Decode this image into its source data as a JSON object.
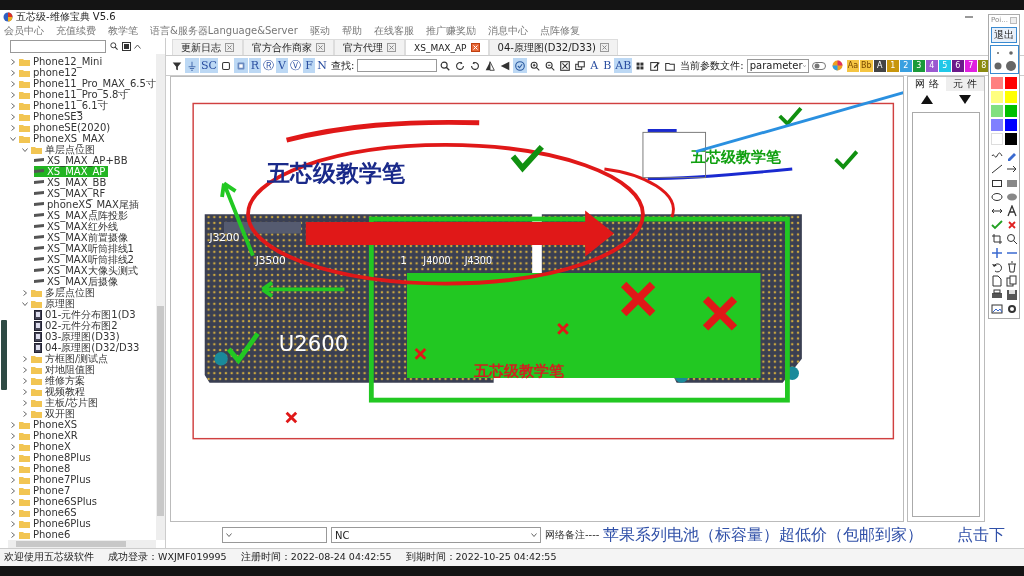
{
  "window": {
    "title": "五芯级-维修宝典 V5.6"
  },
  "menu": [
    "会员中心",
    "充值续费",
    "教学笔",
    "语言&服务器Language&Server",
    "驱动",
    "帮助",
    "在线客服",
    "推广赚奖励",
    "消息中心",
    "点阵修复"
  ],
  "sidebar": {
    "tree": [
      {
        "label": "Phone12_Mini",
        "kind": "folder",
        "expanded": false,
        "selected": false
      },
      {
        "label": "phone12",
        "kind": "folder",
        "expanded": false,
        "selected": false
      },
      {
        "label": "Phone11_Pro_MAX_6.5寸",
        "kind": "folder",
        "expanded": false,
        "selected": false
      },
      {
        "label": "Phone11_Pro_5.8寸",
        "kind": "folder",
        "expanded": false,
        "selected": false
      },
      {
        "label": "Phone11_6.1寸",
        "kind": "folder",
        "expanded": false,
        "selected": false
      },
      {
        "label": "PhoneSE3",
        "kind": "folder",
        "expanded": false,
        "selected": false
      },
      {
        "label": "phoneSE(2020)",
        "kind": "folder",
        "expanded": false,
        "selected": false
      },
      {
        "label": "PhoneXS_MAX",
        "kind": "folder",
        "expanded": true,
        "selected": false,
        "children": [
          {
            "label": "单层点位图",
            "kind": "folder",
            "expanded": true,
            "selected": false,
            "children": [
              {
                "label": "XS_MAX_AP+BB",
                "kind": "board",
                "selected": false
              },
              {
                "label": "XS_MAX_AP",
                "kind": "board",
                "selected": true
              },
              {
                "label": "XS_MAX_BB",
                "kind": "board",
                "selected": false
              },
              {
                "label": "XS_MAX_RF",
                "kind": "board",
                "selected": false
              },
              {
                "label": "phoneXS_MAX尾插",
                "kind": "board",
                "selected": false
              },
              {
                "label": "XS_MAX点阵投影",
                "kind": "board",
                "selected": false
              },
              {
                "label": "XS_MAX红外线",
                "kind": "board",
                "selected": false
              },
              {
                "label": "XS_MAX前置摄像",
                "kind": "board",
                "selected": false
              },
              {
                "label": "XS_MAX听筒排线1",
                "kind": "board",
                "selected": false
              },
              {
                "label": "XS_MAX听筒排线2",
                "kind": "board",
                "selected": false
              },
              {
                "label": "XS_MAX大像头测式",
                "kind": "board",
                "selected": false
              },
              {
                "label": "XS_MAX后摄像",
                "kind": "board",
                "selected": false
              }
            ]
          },
          {
            "label": "多层点位图",
            "kind": "folder",
            "expanded": false,
            "selected": false
          },
          {
            "label": "原理图",
            "kind": "folder",
            "expanded": true,
            "selected": false,
            "children": [
              {
                "label": "01-元件分布图1(D3",
                "kind": "schematic",
                "selected": false
              },
              {
                "label": "02-元件分布图2",
                "kind": "schematic",
                "selected": false
              },
              {
                "label": "03-原理图(D33)",
                "kind": "schematic",
                "selected": false
              },
              {
                "label": "04-原理图(D32/D33",
                "kind": "schematic",
                "selected": false
              }
            ]
          },
          {
            "label": "方框图/测试点",
            "kind": "folder",
            "expanded": false,
            "selected": false
          },
          {
            "label": "对地阻值图",
            "kind": "folder",
            "expanded": false,
            "selected": false
          },
          {
            "label": "维修方案",
            "kind": "folder",
            "expanded": false,
            "selected": false
          },
          {
            "label": "视频教程",
            "kind": "folder",
            "expanded": false,
            "selected": false
          },
          {
            "label": "主板/芯片图",
            "kind": "folder",
            "expanded": false,
            "selected": false
          },
          {
            "label": "双开图",
            "kind": "folder",
            "expanded": false,
            "selected": false
          }
        ]
      },
      {
        "label": "PhoneXS",
        "kind": "folder",
        "expanded": false,
        "selected": false
      },
      {
        "label": "PhoneXR",
        "kind": "folder",
        "expanded": false,
        "selected": false
      },
      {
        "label": "PhoneX",
        "kind": "folder",
        "expanded": false,
        "selected": false
      },
      {
        "label": "Phone8Plus",
        "kind": "folder",
        "expanded": false,
        "selected": false
      },
      {
        "label": "Phone8",
        "kind": "folder",
        "expanded": false,
        "selected": false
      },
      {
        "label": "Phone7Plus",
        "kind": "folder",
        "expanded": false,
        "selected": false
      },
      {
        "label": "Phone7",
        "kind": "folder",
        "expanded": false,
        "selected": false
      },
      {
        "label": "Phone6SPlus",
        "kind": "folder",
        "expanded": false,
        "selected": false
      },
      {
        "label": "Phone6S",
        "kind": "folder",
        "expanded": false,
        "selected": false
      },
      {
        "label": "Phone6Plus",
        "kind": "folder",
        "expanded": false,
        "selected": false
      },
      {
        "label": "Phone6",
        "kind": "folder",
        "expanded": false,
        "selected": false
      }
    ]
  },
  "tabs": [
    {
      "label": "更新日志",
      "selected": false
    },
    {
      "label": "官方合作商家",
      "selected": false
    },
    {
      "label": "官方代理",
      "selected": false
    },
    {
      "label": "XS_MAX_AP",
      "selected": true
    },
    {
      "label": "04-原理图(D32/D33)",
      "selected": false
    }
  ],
  "toolbar": {
    "tools": [
      {
        "kind": "filter",
        "selected": false
      },
      {
        "kind": "ground",
        "selected": true
      },
      {
        "kind": "text",
        "label": "SC",
        "selected": true
      },
      {
        "kind": "square",
        "selected": false
      },
      {
        "kind": "chip",
        "selected": true
      },
      {
        "kind": "text",
        "label": "R",
        "selected": true
      },
      {
        "kind": "text",
        "label": "Ⓡ",
        "selected": false
      },
      {
        "kind": "text",
        "label": "V",
        "selected": true
      },
      {
        "kind": "text",
        "label": "Ⓥ",
        "selected": false
      },
      {
        "kind": "text",
        "label": "F",
        "selected": true
      },
      {
        "kind": "text",
        "label": "N",
        "selected": false
      }
    ],
    "find": {
      "label": "查找:"
    },
    "view_tools": [
      {
        "kind": "search",
        "selected": false
      },
      {
        "kind": "rotate-cw",
        "selected": false
      },
      {
        "kind": "rotate-ccw",
        "selected": false
      },
      {
        "kind": "flip-v",
        "selected": false
      },
      {
        "kind": "flip-h",
        "selected": false
      },
      {
        "kind": "check-circle",
        "selected": true
      },
      {
        "kind": "zoom-in",
        "selected": false
      },
      {
        "kind": "zoom-out",
        "selected": false
      },
      {
        "kind": "fit",
        "selected": false
      },
      {
        "kind": "window",
        "selected": false
      },
      {
        "kind": "text",
        "label": "A",
        "selected": false
      },
      {
        "kind": "text",
        "label": "B",
        "selected": false
      },
      {
        "kind": "text",
        "label": "AB",
        "selected": true
      },
      {
        "kind": "grid",
        "selected": false
      },
      {
        "kind": "edit",
        "selected": false
      },
      {
        "kind": "folder",
        "selected": false
      }
    ],
    "param": {
      "label": "当前参数文件:",
      "value": "parameter"
    },
    "swatches": [
      {
        "label": "Aa",
        "color": "#f5c542"
      },
      {
        "label": "Bb",
        "color": "#f5c542"
      },
      {
        "label": "A",
        "color": "#444444"
      },
      {
        "label": "1",
        "color": "#c8960c"
      },
      {
        "label": "2",
        "color": "#3aa0e0"
      },
      {
        "label": "3",
        "color": "#1a9a3a"
      },
      {
        "label": "4",
        "color": "#9b59d0"
      },
      {
        "label": "5",
        "color": "#20c8e8"
      },
      {
        "label": "6",
        "color": "#6a1a8a"
      },
      {
        "label": "7",
        "color": "#e020e0"
      },
      {
        "label": "8",
        "color": "#8a8a10"
      }
    ]
  },
  "canvas": {
    "board_labels": [
      "J3200",
      "J3500",
      "J4000",
      "J4300",
      "U2600",
      "1"
    ],
    "annotation_texts": [
      "五芯级教学笔",
      "五芯级教学笔",
      "五芯级教学笔"
    ]
  },
  "net_panel": {
    "tabs": [
      {
        "label": "网 络",
        "selected": true
      },
      {
        "label": "元 件",
        "selected": false
      }
    ]
  },
  "bottom_bar": {
    "net_value": "NC",
    "note_label": "网络备注----",
    "ad_text": "苹果系列电池（标容量）超低价（包邮到家）",
    "ad_link": "点击下"
  },
  "status_bar": [
    "欢迎使用五芯级软件",
    "成功登录：WXJMF019995",
    "注册时间：2022-08-24 04:42:55",
    "到期时间：2022-10-25 04:42:55"
  ],
  "palette": {
    "title": "Poi...",
    "exit_button": "退出",
    "colors": [
      {
        "color": "#ff8080"
      },
      {
        "color": "#ff0000"
      },
      {
        "color": "#ffff80"
      },
      {
        "color": "#ffff00"
      },
      {
        "color": "#80e080"
      },
      {
        "color": "#00c000"
      },
      {
        "color": "#8080ff"
      },
      {
        "color": "#0000ff"
      },
      {
        "color": "#ffffff"
      },
      {
        "color": "#000000"
      }
    ]
  }
}
